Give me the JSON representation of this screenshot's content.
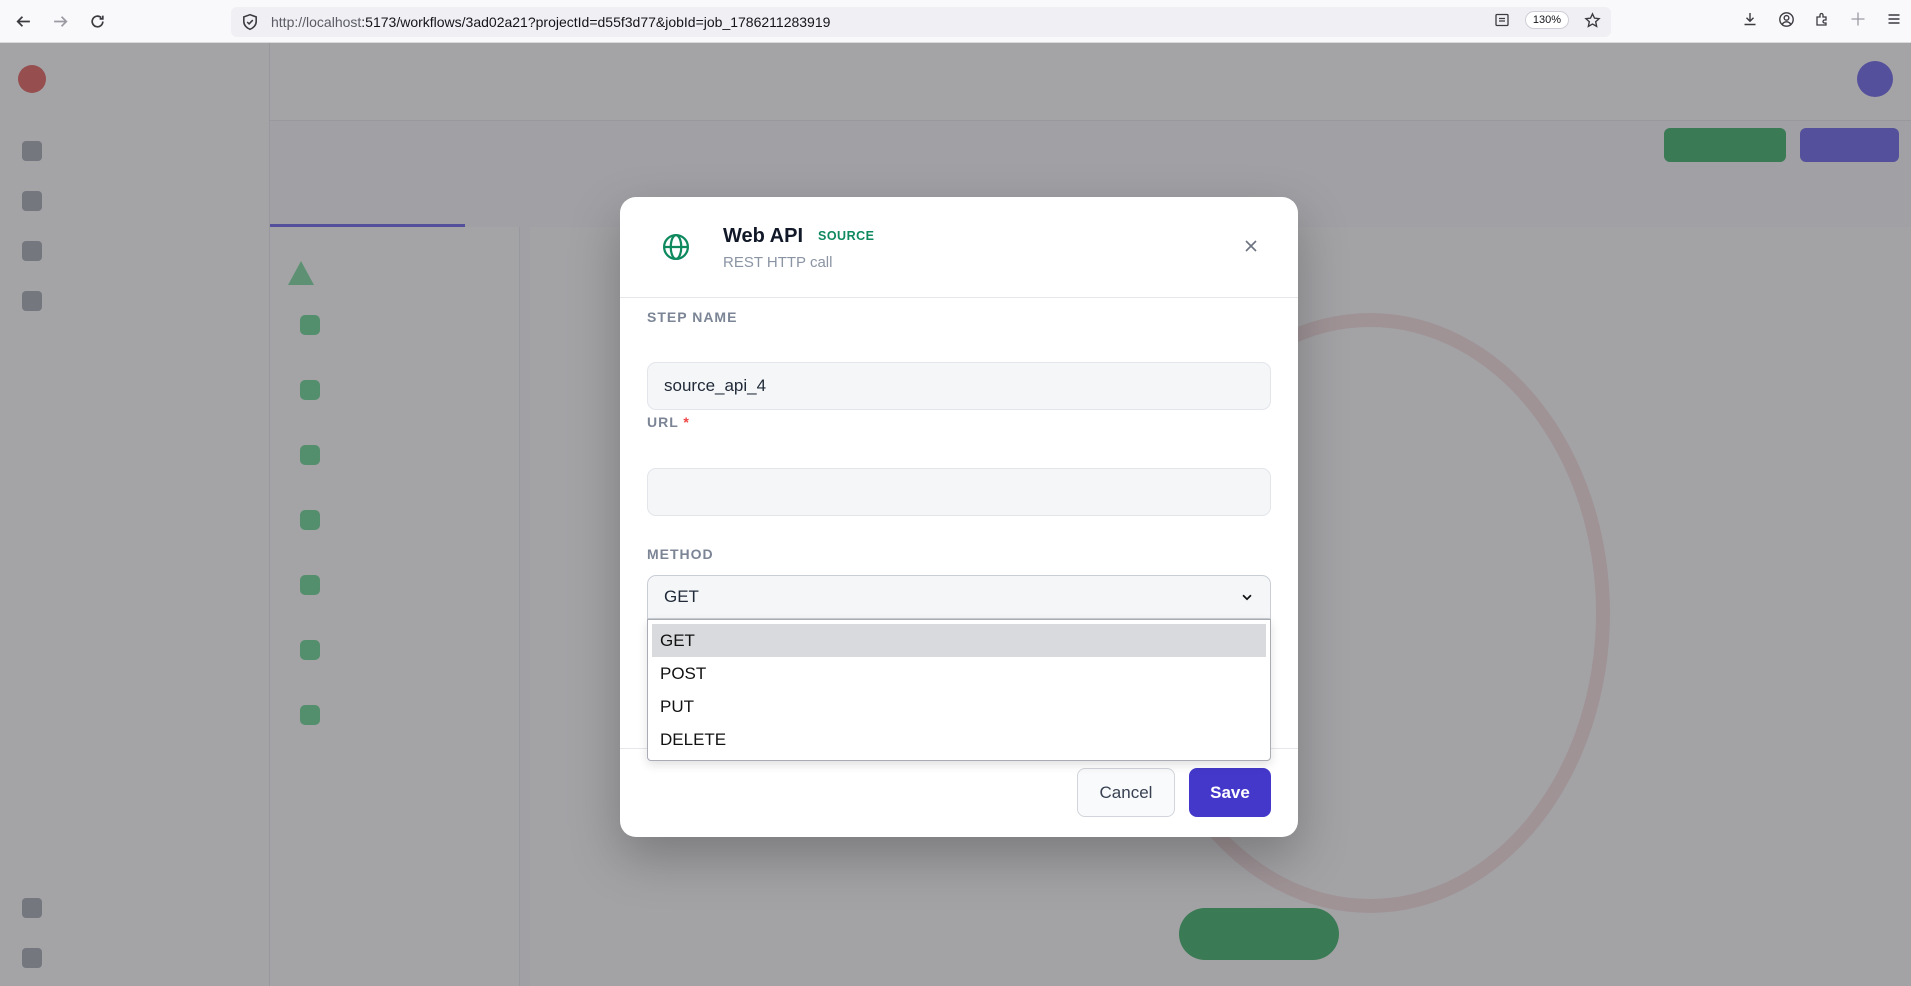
{
  "browser": {
    "url_host": "http://localhost",
    "url_rest": ":5173/workflows/3ad02a21?projectId=d55f3d77&jobId=job_1786211283919",
    "zoom": "130%"
  },
  "modal": {
    "title": "Web API",
    "badge": "SOURCE",
    "subtitle": "REST HTTP call",
    "fields": {
      "step_name_label": "STEP NAME",
      "step_name_value": "source_api_4",
      "url_label": "URL",
      "url_required": "*",
      "url_value": "",
      "method_label": "METHOD",
      "method_value": "GET"
    },
    "method_options": [
      "GET",
      "POST",
      "PUT",
      "DELETE"
    ],
    "selected_option": "GET",
    "cancel_label": "Cancel",
    "save_label": "Save"
  },
  "colors": {
    "accent": "#4338ca",
    "source_green": "#0f8a5f",
    "required_red": "#ef4444"
  },
  "icons": {
    "modal": "globe-icon",
    "close": "close-icon",
    "select": "chevron-down-icon"
  }
}
